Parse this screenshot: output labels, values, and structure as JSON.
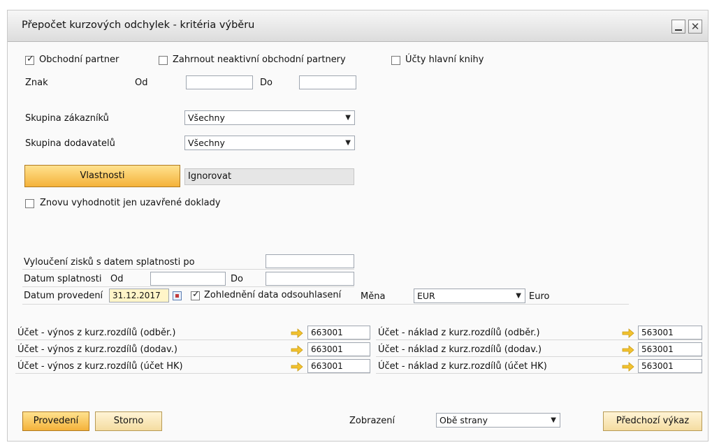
{
  "window": {
    "title": "Přepočet kurzových odchylek - kritéria výběru"
  },
  "top": {
    "obchodni_partner": "Obchodní partner",
    "zahrnout": "Zahrnout neaktivní obchodní partnery",
    "ucty_hlavni": "Účty hlavní knihy",
    "znak": "Znak",
    "od": "Od",
    "do": "Do"
  },
  "groups": {
    "skupina_zakazniku_label": "Skupina zákazníků",
    "skupina_zakazniku_value": "Všechny",
    "skupina_dodavatelu_label": "Skupina dodavatelů",
    "skupina_dodavatelu_value": "Všechny"
  },
  "vlastnosti": {
    "button": "Vlastnosti",
    "value": "Ignorovat"
  },
  "znovu": "Znovu vyhodnotit jen uzavřené doklady",
  "dates": {
    "vylouceni": "Vyloučení zisků s datem splatnosti po",
    "datum_splatnosti": "Datum splatnosti",
    "od": "Od",
    "do": "Do",
    "datum_provedeni": "Datum provedení",
    "datum_provedeni_value": "31.12.2017",
    "zohledneni": "Zohlednění data odsouhlasení",
    "mena_label": "Měna",
    "mena_value": "EUR",
    "mena_name": "Euro"
  },
  "accounts": {
    "left": [
      {
        "label": "Účet - výnos z kurz.rozdílů (odběr.)",
        "value": "663001"
      },
      {
        "label": "Účet - výnos z kurz.rozdílů (dodav.)",
        "value": "663001"
      },
      {
        "label": "Účet - výnos z kurz.rozdílů (účet HK)",
        "value": "663001"
      }
    ],
    "right": [
      {
        "label": "Účet - náklad z kurz.rozdílů (odběr.)",
        "value": "563001"
      },
      {
        "label": "Účet - náklad z kurz.rozdílů (dodav.)",
        "value": "563001"
      },
      {
        "label": "Účet - náklad z kurz.rozdílů (účet HK)",
        "value": "563001"
      }
    ]
  },
  "footer": {
    "provedeni": "Provedení",
    "storno": "Storno",
    "zobrazeni_label": "Zobrazení",
    "zobrazeni_value": "Obě strany",
    "predchozi": "Předchozí výkaz"
  },
  "colors": {
    "accent_orange": "#f4b23a",
    "link_arrow": "#f2c230",
    "field_yellow": "#fff5c8"
  }
}
